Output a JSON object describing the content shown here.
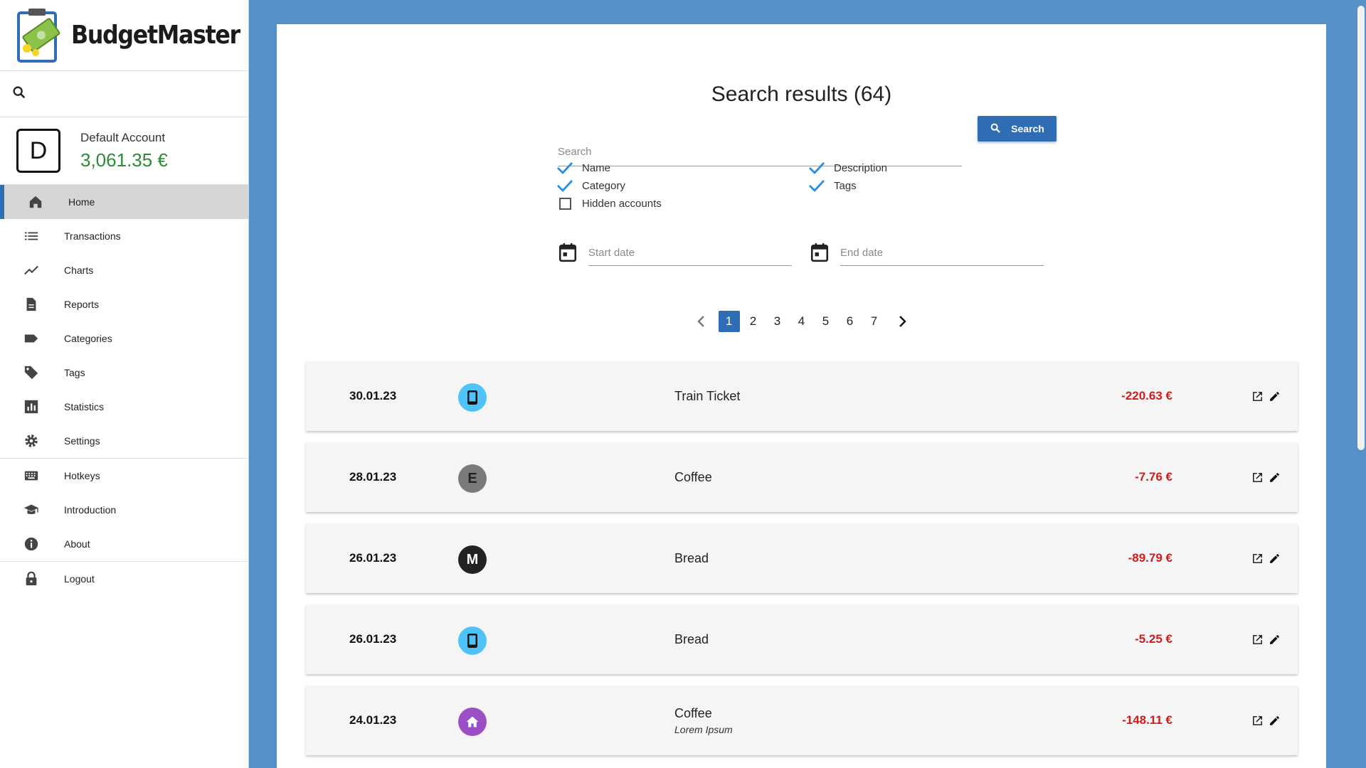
{
  "app": {
    "title": "BudgetMaster"
  },
  "account": {
    "initial": "D",
    "name": "Default Account",
    "balance": "3,061.35 €"
  },
  "nav": {
    "items": [
      {
        "label": "Home",
        "icon": "home-icon"
      },
      {
        "label": "Transactions",
        "icon": "list-icon"
      },
      {
        "label": "Charts",
        "icon": "trending-line-icon"
      },
      {
        "label": "Reports",
        "icon": "document-icon"
      },
      {
        "label": "Categories",
        "icon": "label-icon"
      },
      {
        "label": "Tags",
        "icon": "tag-icon"
      },
      {
        "label": "Statistics",
        "icon": "bar-chart-icon"
      },
      {
        "label": "Settings",
        "icon": "gear-icon"
      },
      {
        "label": "Hotkeys",
        "icon": "keyboard-icon"
      },
      {
        "label": "Introduction",
        "icon": "school-icon"
      },
      {
        "label": "About",
        "icon": "info-icon"
      },
      {
        "label": "Logout",
        "icon": "lock-icon"
      }
    ],
    "active": "Home"
  },
  "main": {
    "title": "Search results (64)",
    "search": {
      "placeholder": "Search",
      "value": "",
      "button_label": "Search"
    },
    "filters": [
      {
        "label": "Name",
        "checked": true
      },
      {
        "label": "Description",
        "checked": true
      },
      {
        "label": "Category",
        "checked": true
      },
      {
        "label": "Tags",
        "checked": true
      },
      {
        "label": "Hidden accounts",
        "checked": false
      }
    ],
    "start_date": {
      "placeholder": "Start date"
    },
    "end_date": {
      "placeholder": "End date"
    },
    "pagination": {
      "pages": [
        "1",
        "2",
        "3",
        "4",
        "5",
        "6",
        "7"
      ],
      "current": "1"
    },
    "results": [
      {
        "date": "30.01.23",
        "icon_type": "phone",
        "icon_letter": "",
        "icon_color": "#4fc3f7",
        "name": "Train Ticket",
        "description": "",
        "amount": "-220.63 €"
      },
      {
        "date": "28.01.23",
        "icon_type": "letter",
        "icon_letter": "E",
        "icon_color": "#7a7a7a",
        "name": "Coffee",
        "description": "",
        "amount": "-7.76 €"
      },
      {
        "date": "26.01.23",
        "icon_type": "letter",
        "icon_letter": "M",
        "icon_color": "#222222",
        "name": "Bread",
        "description": "",
        "amount": "-89.79 €"
      },
      {
        "date": "26.01.23",
        "icon_type": "phone",
        "icon_letter": "",
        "icon_color": "#4fc3f7",
        "name": "Bread",
        "description": "",
        "amount": "-5.25 €"
      },
      {
        "date": "24.01.23",
        "icon_type": "home",
        "icon_letter": "",
        "icon_color": "#9c4fc4",
        "name": "Coffee",
        "description": "Lorem Ipsum",
        "amount": "-148.11 €"
      }
    ]
  },
  "colors": {
    "accent": "#2f6db5",
    "background": "#5590c8",
    "positive": "#2e8b35",
    "negative": "#d31b1b"
  }
}
